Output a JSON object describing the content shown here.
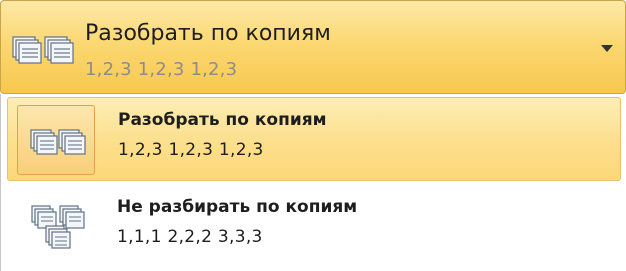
{
  "combo": {
    "selected_title": "Разобрать по копиям",
    "selected_sub": "1,2,3   1,2,3   1,2,3",
    "icon": "collated-pages-icon",
    "dropdown_icon": "chevron-down-icon"
  },
  "options": [
    {
      "label": "Разобрать по копиям",
      "desc": "1,2,3   1,2,3   1,2,3",
      "icon": "collated-pages-icon",
      "selected": true
    },
    {
      "label": "Не разбирать по копиям",
      "desc": "1,1,1   2,2,2   3,3,3",
      "icon": "uncollated-pages-icon",
      "selected": false
    }
  ],
  "colors": {
    "highlight_top": "#fde9a7",
    "highlight_bottom": "#f7c84e",
    "border": "#c9a44a"
  }
}
